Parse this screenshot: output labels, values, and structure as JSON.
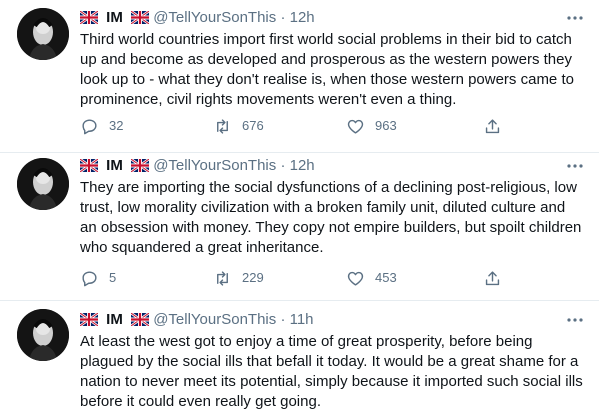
{
  "colors": {
    "accent": "#1da1f2",
    "secondary_text": "#5b7083",
    "divider": "#e6ecf0"
  },
  "icons": {
    "reply": "comment-icon",
    "retweet": "retweet-icon",
    "like": "heart-icon",
    "share": "share-icon",
    "more": "more-icon",
    "flag": "uk-flag-icon"
  },
  "tweets": [
    {
      "name": "IM",
      "handle": "@TellYourSonThis",
      "sep": "·",
      "time": "12h",
      "text": "Third world countries import first world social problems in their bid to catch up and become as developed and prosperous as the western powers they look up to - what they don't realise is, when those western powers came to prominence, civil rights movements weren't even a thing.",
      "replies": "32",
      "retweets": "676",
      "likes": "963"
    },
    {
      "name": "IM",
      "handle": "@TellYourSonThis",
      "sep": "·",
      "time": "12h",
      "text": "They are importing the social dysfunctions of a declining post-religious, low trust, low morality civilization with a broken family unit, diluted culture and an obsession with money. They copy not empire builders, but spoilt children who squandered a great inheritance.",
      "replies": "5",
      "retweets": "229",
      "likes": "453"
    },
    {
      "name": "IM",
      "handle": "@TellYourSonThis",
      "sep": "·",
      "time": "11h",
      "text": "At least the west got to enjoy a time of great prosperity, before being plagued by the social ills that befall it today. It would be a great shame for a nation to never meet its potential, simply because it imported such social ills before it could even really get going."
    }
  ]
}
